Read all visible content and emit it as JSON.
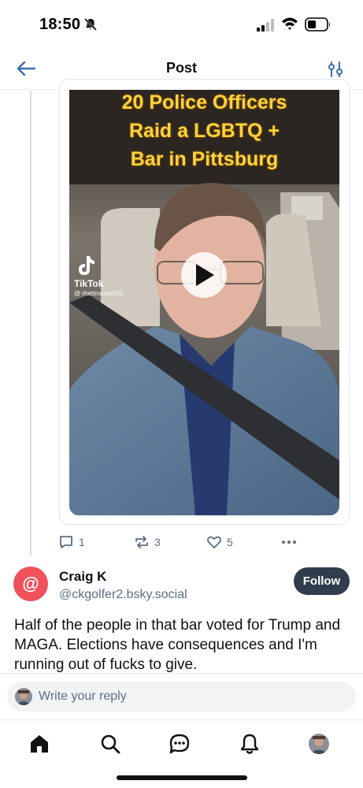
{
  "status_bar": {
    "time": "18:50"
  },
  "header": {
    "title": "Post"
  },
  "embed": {
    "caption_lines": [
      "20 Police Officers",
      "Raid a LGBTQ +",
      "Bar in Pittsburg"
    ],
    "watermark_label": "TikTok",
    "watermark_user": "@ rhettmoore552"
  },
  "actions": {
    "replies": "1",
    "reposts": "3",
    "likes": "5"
  },
  "reply": {
    "display_name": "Craig K",
    "handle": "@ckgolfer2.bsky.social",
    "follow_label": "Follow",
    "text": "Half of the people in that bar voted for Trump and MAGA. Elections have consequences and I'm running out of fucks to give.",
    "avatar_color": "#f0515b"
  },
  "composer": {
    "placeholder": "Write your reply"
  },
  "icons": {
    "status": [
      "bell-slash-icon",
      "signal-icon",
      "wifi-icon",
      "battery-icon"
    ],
    "header": [
      "back-arrow-icon",
      "filter-icon"
    ],
    "actions": [
      "reply-icon",
      "repost-icon",
      "like-icon",
      "more-icon"
    ],
    "tabbar": [
      "home-icon",
      "search-icon",
      "chat-icon",
      "bell-icon",
      "profile-avatar"
    ]
  }
}
